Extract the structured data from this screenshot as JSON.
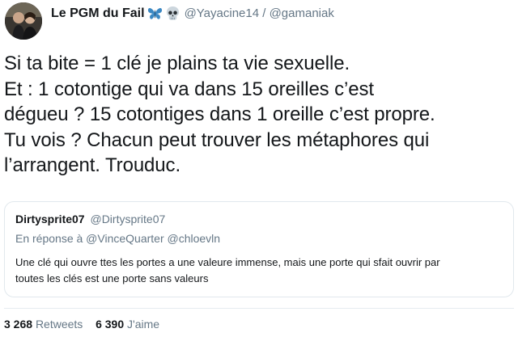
{
  "author": {
    "display_name": "Le PGM du Fail",
    "handle_line": "@Yayacine14 / @gamaniak",
    "emoji_icons": [
      "butterfly-icon",
      "skull-icon"
    ],
    "butterfly_color": "#3b88c3"
  },
  "tweet": {
    "lines": [
      "Si ta bite = 1 clé je plains ta vie sexuelle.",
      "Et : 1 cotontige qui va dans 15 oreilles c’est",
      "dégueu ? 15 cotontiges dans 1 oreille c’est propre.",
      "Tu vois ? Chacun peut trouver les métaphores qui",
      "l’arrangent. Trouduc."
    ]
  },
  "quote": {
    "name": "Dirtysprite07",
    "handle": "@Dirtysprite07",
    "reply_line": "En réponse à @VinceQuarter @chloevln",
    "lines": [
      "Une clé qui ouvre ttes les portes a une valeure immense, mais une porte qui sfait ouvrir par",
      "toutes les clés est une porte sans valeurs"
    ]
  },
  "stats": {
    "retweets_count": "3 268",
    "retweets_label": "Retweets",
    "likes_count": "6 390",
    "likes_label": "J'aime"
  },
  "colors": {
    "text": "#14171a",
    "secondary": "#657786",
    "border": "#e1e8ed"
  }
}
